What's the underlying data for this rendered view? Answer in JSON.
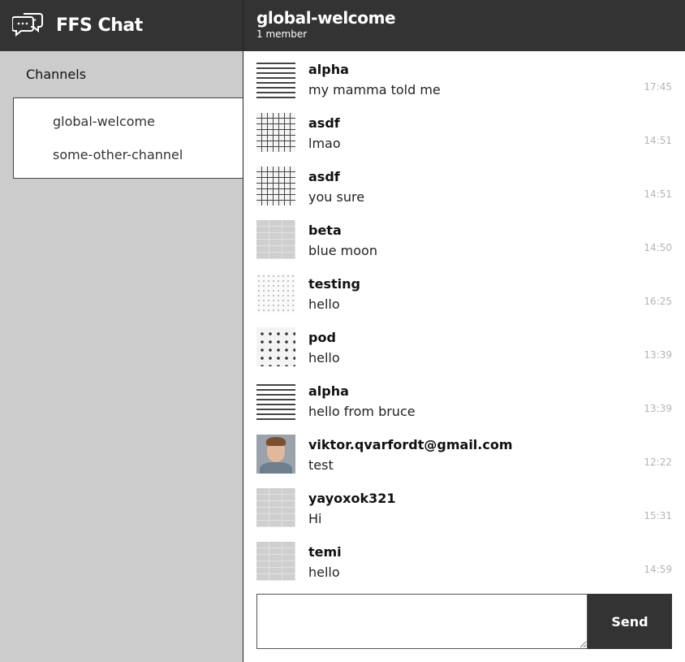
{
  "app": {
    "title": "FFS Chat",
    "icon": "chat-bubbles-icon"
  },
  "sidebar": {
    "heading": "Channels",
    "channels": [
      {
        "label": "global-welcome"
      },
      {
        "label": "some-other-channel"
      }
    ]
  },
  "header": {
    "title": "global-welcome",
    "members": "1 member"
  },
  "messages": [
    {
      "user": "alpha",
      "text": "my mamma told me",
      "time": "17:45",
      "avatar": "lines"
    },
    {
      "user": "asdf",
      "text": "lmao",
      "time": "14:51",
      "avatar": "grid"
    },
    {
      "user": "asdf",
      "text": "you sure",
      "time": "14:51",
      "avatar": "grid"
    },
    {
      "user": "beta",
      "text": "blue moon",
      "time": "14:50",
      "avatar": "brick"
    },
    {
      "user": "testing",
      "text": "hello",
      "time": "16:25",
      "avatar": "dots"
    },
    {
      "user": "pod",
      "text": "hello",
      "time": "13:39",
      "avatar": "triangles"
    },
    {
      "user": "alpha",
      "text": "hello from bruce",
      "time": "13:39",
      "avatar": "lines"
    },
    {
      "user": "viktor.qvarfordt@gmail.com",
      "text": "test",
      "time": "12:22",
      "avatar": "photo"
    },
    {
      "user": "yayoxok321",
      "text": "Hi",
      "time": "15:31",
      "avatar": "brick"
    },
    {
      "user": "temi",
      "text": "hello",
      "time": "14:59",
      "avatar": "brick"
    }
  ],
  "composer": {
    "placeholder": "",
    "send_label": "Send"
  },
  "colors": {
    "dark": "#333333",
    "sidebar": "#cccccc",
    "time": "#b5b5b5"
  }
}
